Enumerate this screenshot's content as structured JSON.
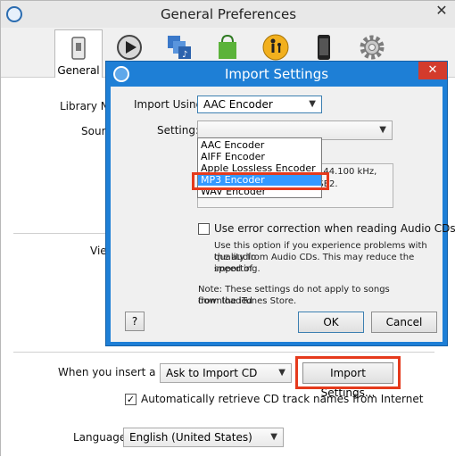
{
  "main_window": {
    "title": "General Preferences",
    "toolbar": [
      {
        "name": "general",
        "label": "General",
        "icon": "general-icon"
      },
      {
        "name": "playback",
        "icon": "play-icon"
      },
      {
        "name": "sharing",
        "icon": "sharing-icon"
      },
      {
        "name": "store",
        "icon": "store-bag-icon"
      },
      {
        "name": "parental",
        "icon": "parental-icon"
      },
      {
        "name": "devices",
        "icon": "device-icon"
      },
      {
        "name": "advanced",
        "icon": "gear-icon"
      }
    ],
    "labels": {
      "library_name": "Library Na",
      "source": "Sourc",
      "view": "Vie"
    },
    "insert_cd": {
      "label": "When you insert a CD:",
      "value": "Ask to Import CD",
      "import_settings_button": "Import Settings..."
    },
    "auto_retrieve": {
      "checked": true,
      "label": "Automatically retrieve CD track names from Internet"
    },
    "language": {
      "label": "Language:",
      "value": "English (United States)"
    }
  },
  "dialog": {
    "title": "Import Settings",
    "import_using": {
      "label": "Import Using:",
      "value": "AAC Encoder",
      "options": [
        "AAC Encoder",
        "AIFF Encoder",
        "Apple Lossless Encoder",
        "MP3 Encoder",
        "WAV Encoder"
      ],
      "selected_index": 3
    },
    "setting": {
      "label": "Setting:"
    },
    "info_text_line1": "o), 44.100 kHz,",
    "info_text_line2": "VBR, optimized for MMX/SSE2.",
    "error_correction": {
      "checked": false,
      "label": "Use error correction when reading Audio CDs",
      "help_line1": "Use this option if you experience problems with the audio",
      "help_line2": "quality from Audio CDs.  This may reduce the speed of",
      "help_line3": "importing."
    },
    "note_line1": "Note: These settings do not apply to songs downloaded",
    "note_line2": "from the iTunes Store.",
    "help_button": "?",
    "ok_button": "OK",
    "cancel_button": "Cancel"
  },
  "colors": {
    "dialog_accent": "#1e7fd6",
    "close_red": "#d33b2c",
    "highlight": "#e53a1c",
    "selection": "#3399ff"
  }
}
